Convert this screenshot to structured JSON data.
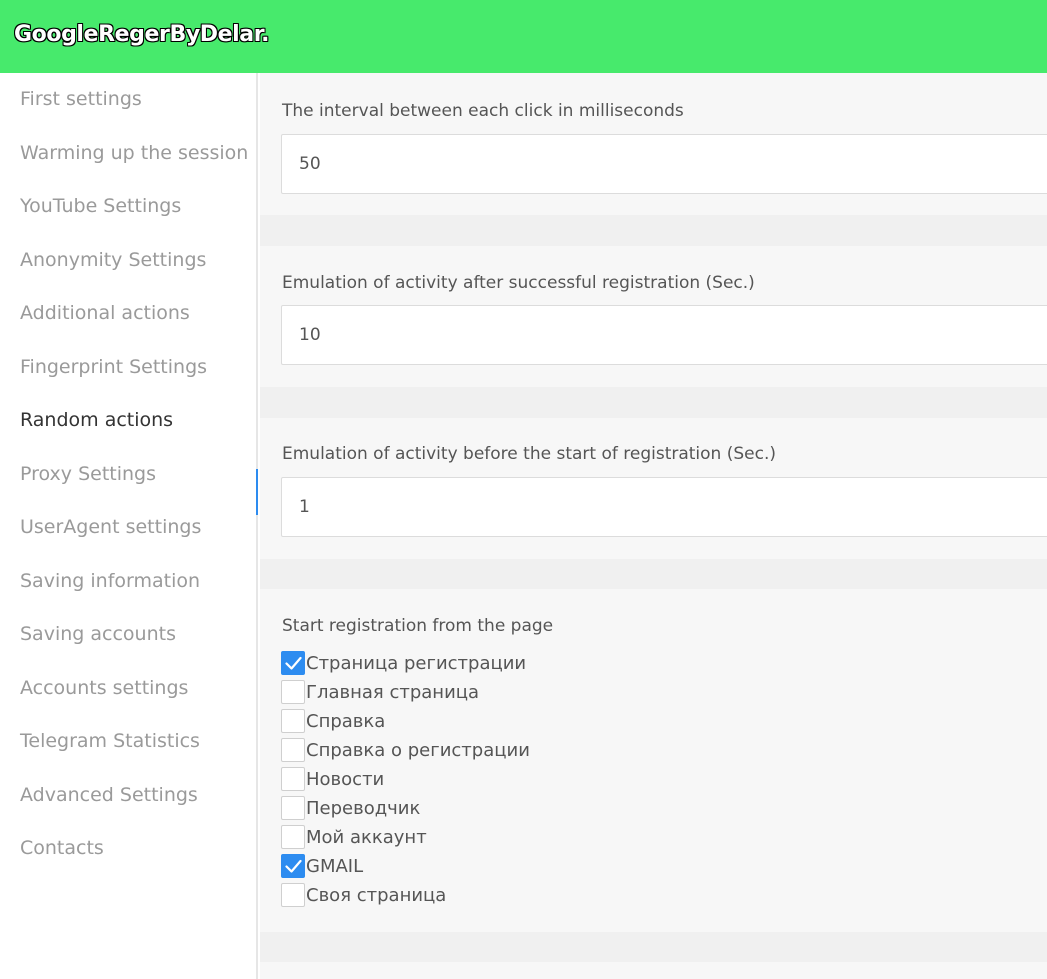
{
  "app": {
    "title": "GoogleRegerByDelar."
  },
  "sidebar": {
    "items": [
      {
        "label": "First settings"
      },
      {
        "label": "Warming up the session"
      },
      {
        "label": "YouTube Settings"
      },
      {
        "label": "Anonymity Settings"
      },
      {
        "label": "Additional actions"
      },
      {
        "label": "Fingerprint Settings"
      },
      {
        "label": "Random actions"
      },
      {
        "label": "Proxy Settings"
      },
      {
        "label": "UserAgent settings"
      },
      {
        "label": "Saving information"
      },
      {
        "label": "Saving accounts"
      },
      {
        "label": "Accounts settings"
      },
      {
        "label": "Telegram Statistics"
      },
      {
        "label": "Advanced Settings"
      },
      {
        "label": "Contacts"
      }
    ],
    "active": "Random actions"
  },
  "main": {
    "click_interval": {
      "label": "The interval between each click in milliseconds",
      "value": "50"
    },
    "after_registration": {
      "label": "Emulation of activity after successful registration (Sec.)",
      "value": "10"
    },
    "before_registration": {
      "label": "Emulation of activity before the start of registration (Sec.)",
      "value": "1"
    },
    "start_page": {
      "label": "Start registration from the page",
      "options": [
        {
          "label": "Страница регистрации",
          "checked": true
        },
        {
          "label": "Главная страница",
          "checked": false
        },
        {
          "label": "Справка",
          "checked": false
        },
        {
          "label": "Справка о регистрации",
          "checked": false
        },
        {
          "label": "Новости",
          "checked": false
        },
        {
          "label": "Переводчик",
          "checked": false
        },
        {
          "label": "Мой аккаунт",
          "checked": false
        },
        {
          "label": "GMAIL",
          "checked": true
        },
        {
          "label": "Своя страница",
          "checked": false
        }
      ]
    }
  },
  "colors": {
    "header": "#47ea6c",
    "accent": "#2d8cf0"
  }
}
